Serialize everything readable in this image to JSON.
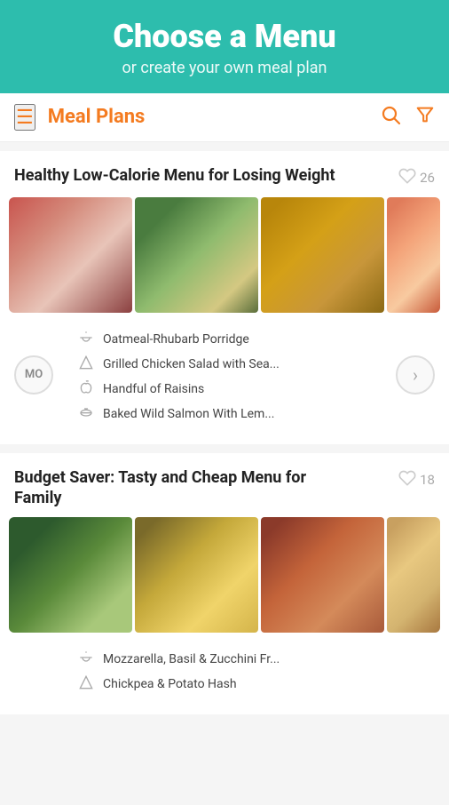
{
  "hero": {
    "title": "Choose a Menu",
    "subtitle": "or create your own meal plan"
  },
  "nav": {
    "title": "Meal Plans",
    "menu_icon": "☰",
    "search_icon": "🔍",
    "filter_icon": "▽"
  },
  "plans": [
    {
      "id": "plan-1",
      "title": "Healthy Low-Calorie Menu for Losing Weight",
      "likes": "26",
      "avatar": "MO",
      "items": [
        {
          "icon": "bowl",
          "name": "Oatmeal-Rhubarb Porridge"
        },
        {
          "icon": "pizza-slice",
          "name": "Grilled Chicken Salad with Sea..."
        },
        {
          "icon": "apple",
          "name": "Handful of Raisins"
        },
        {
          "icon": "dish",
          "name": "Baked Wild Salmon With Lem..."
        }
      ],
      "images": [
        "img-oatmeal",
        "img-sandwich",
        "img-raisins",
        "img-salmon"
      ]
    },
    {
      "id": "plan-2",
      "title": "Budget Saver: Tasty and Cheap Menu for Family",
      "likes": "18",
      "avatar": "",
      "items": [
        {
          "icon": "bowl",
          "name": "Mozzarella, Basil & Zucchini Fr..."
        },
        {
          "icon": "pizza-slice",
          "name": "Chickpea & Potato Hash"
        }
      ],
      "images": [
        "img-pizza",
        "img-eggs",
        "img-casserole",
        "img-sandwich2"
      ]
    }
  ],
  "icons": {
    "bowl": "☕",
    "pizza-slice": "🍕",
    "apple": "🍎",
    "dish": "🍽"
  }
}
